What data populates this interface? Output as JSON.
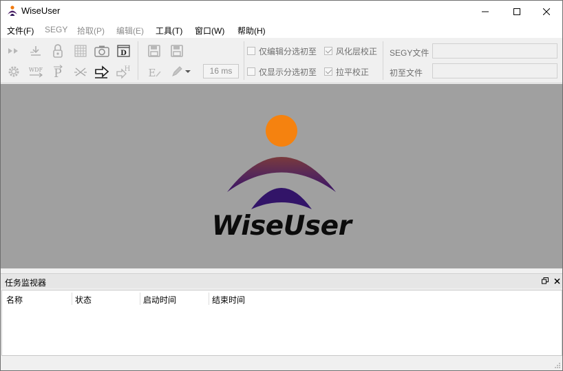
{
  "window": {
    "title": "WiseUser",
    "controls": [
      "minimize",
      "maximize",
      "close"
    ]
  },
  "menu": {
    "items": [
      {
        "label": "文件(F)",
        "enabled": true
      },
      {
        "label": "SEGY",
        "enabled": false
      },
      {
        "label": "拾取(P)",
        "enabled": false
      },
      {
        "label": "编辑(E)",
        "enabled": false
      },
      {
        "label": "工具(T)",
        "enabled": true
      },
      {
        "label": "窗口(W)",
        "enabled": true
      },
      {
        "label": "帮助(H)",
        "enabled": true
      }
    ]
  },
  "toolbar": {
    "icons": [
      "fast-forward-icon",
      "import-arrow-icon",
      "lock-icon",
      "grid-icon",
      "camera-icon",
      "d-document-icon",
      "save-icon",
      "save-all-icon",
      "gear-icon",
      "wdf-icon",
      "p-icon",
      "x-arrows-icon",
      "export-arrow-icon",
      "h-arrow-icon",
      "e-edit-icon",
      "pencil-icon",
      "dropdown-arrow-icon"
    ],
    "wdf_text": "WDF",
    "interval": "16 ms",
    "checkboxes": [
      {
        "label": "仅编辑分选初至",
        "checked": false
      },
      {
        "label": "风化层校正",
        "checked": true
      },
      {
        "label": "仅显示分选初至",
        "checked": false
      },
      {
        "label": "拉平校正",
        "checked": true
      }
    ],
    "segy_file_label": "SEGY文件",
    "segy_file_value": "",
    "first_break_file_label": "初至文件",
    "first_break_file_value": ""
  },
  "splash": {
    "logo_text": "WiseUser"
  },
  "task_monitor": {
    "title": "任务监视器",
    "columns": [
      "名称",
      "状态",
      "启动时间",
      "结束时间"
    ],
    "rows": []
  }
}
